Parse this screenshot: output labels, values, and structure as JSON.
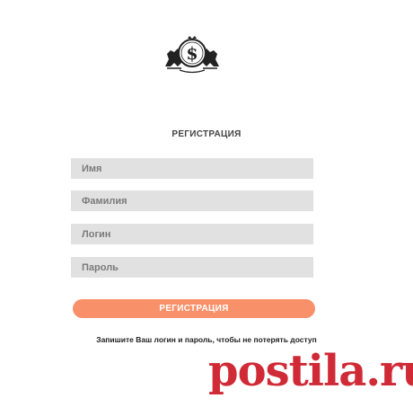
{
  "logo": {
    "icon": "dollar-coin-lions-emblem",
    "symbol": "$"
  },
  "form": {
    "title": "РЕГИСТРАЦИЯ",
    "fields": [
      {
        "placeholder": "Имя",
        "value": ""
      },
      {
        "placeholder": "Фамилия",
        "value": ""
      },
      {
        "placeholder": "Логин",
        "value": ""
      },
      {
        "placeholder": "Пароль",
        "value": ""
      }
    ],
    "submit_label": "РЕГИСТРАЦИЯ",
    "note": "Запишите Ваш логин и пароль, чтобы не потерять доступ"
  },
  "watermark": {
    "text": "postila.ru"
  },
  "colors": {
    "button": "#f8916a",
    "field_bg": "#e1e1e1",
    "watermark": "#cf2a36"
  }
}
